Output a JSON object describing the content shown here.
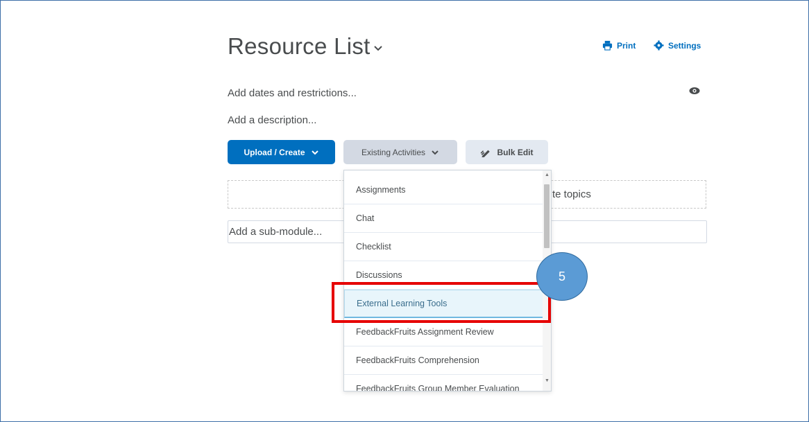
{
  "page": {
    "title": "Resource List",
    "header_links": {
      "print": "Print",
      "settings": "Settings"
    },
    "dates_link": "Add dates and restrictions...",
    "description_link": "Add a description..."
  },
  "toolbar": {
    "upload_create": "Upload / Create",
    "existing_activities": "Existing Activities",
    "bulk_edit": "Bulk Edit"
  },
  "dropzone": {
    "text": "te topics"
  },
  "submodule": {
    "placeholder": "Add a sub-module..."
  },
  "dropdown": {
    "items": [
      "Assignments",
      "Chat",
      "Checklist",
      "Discussions",
      "External Learning Tools",
      "FeedbackFruits Assignment Review",
      "FeedbackFruits Comprehension",
      "FeedbackFruits Group Member Evaluation"
    ],
    "highlighted": "External Learning Tools"
  },
  "annotation": {
    "step_number": "5",
    "highlight_color": "#e60000",
    "badge_color": "#5b9bd5"
  },
  "colors": {
    "accent": "#006fbf",
    "text": "#494c4e"
  }
}
